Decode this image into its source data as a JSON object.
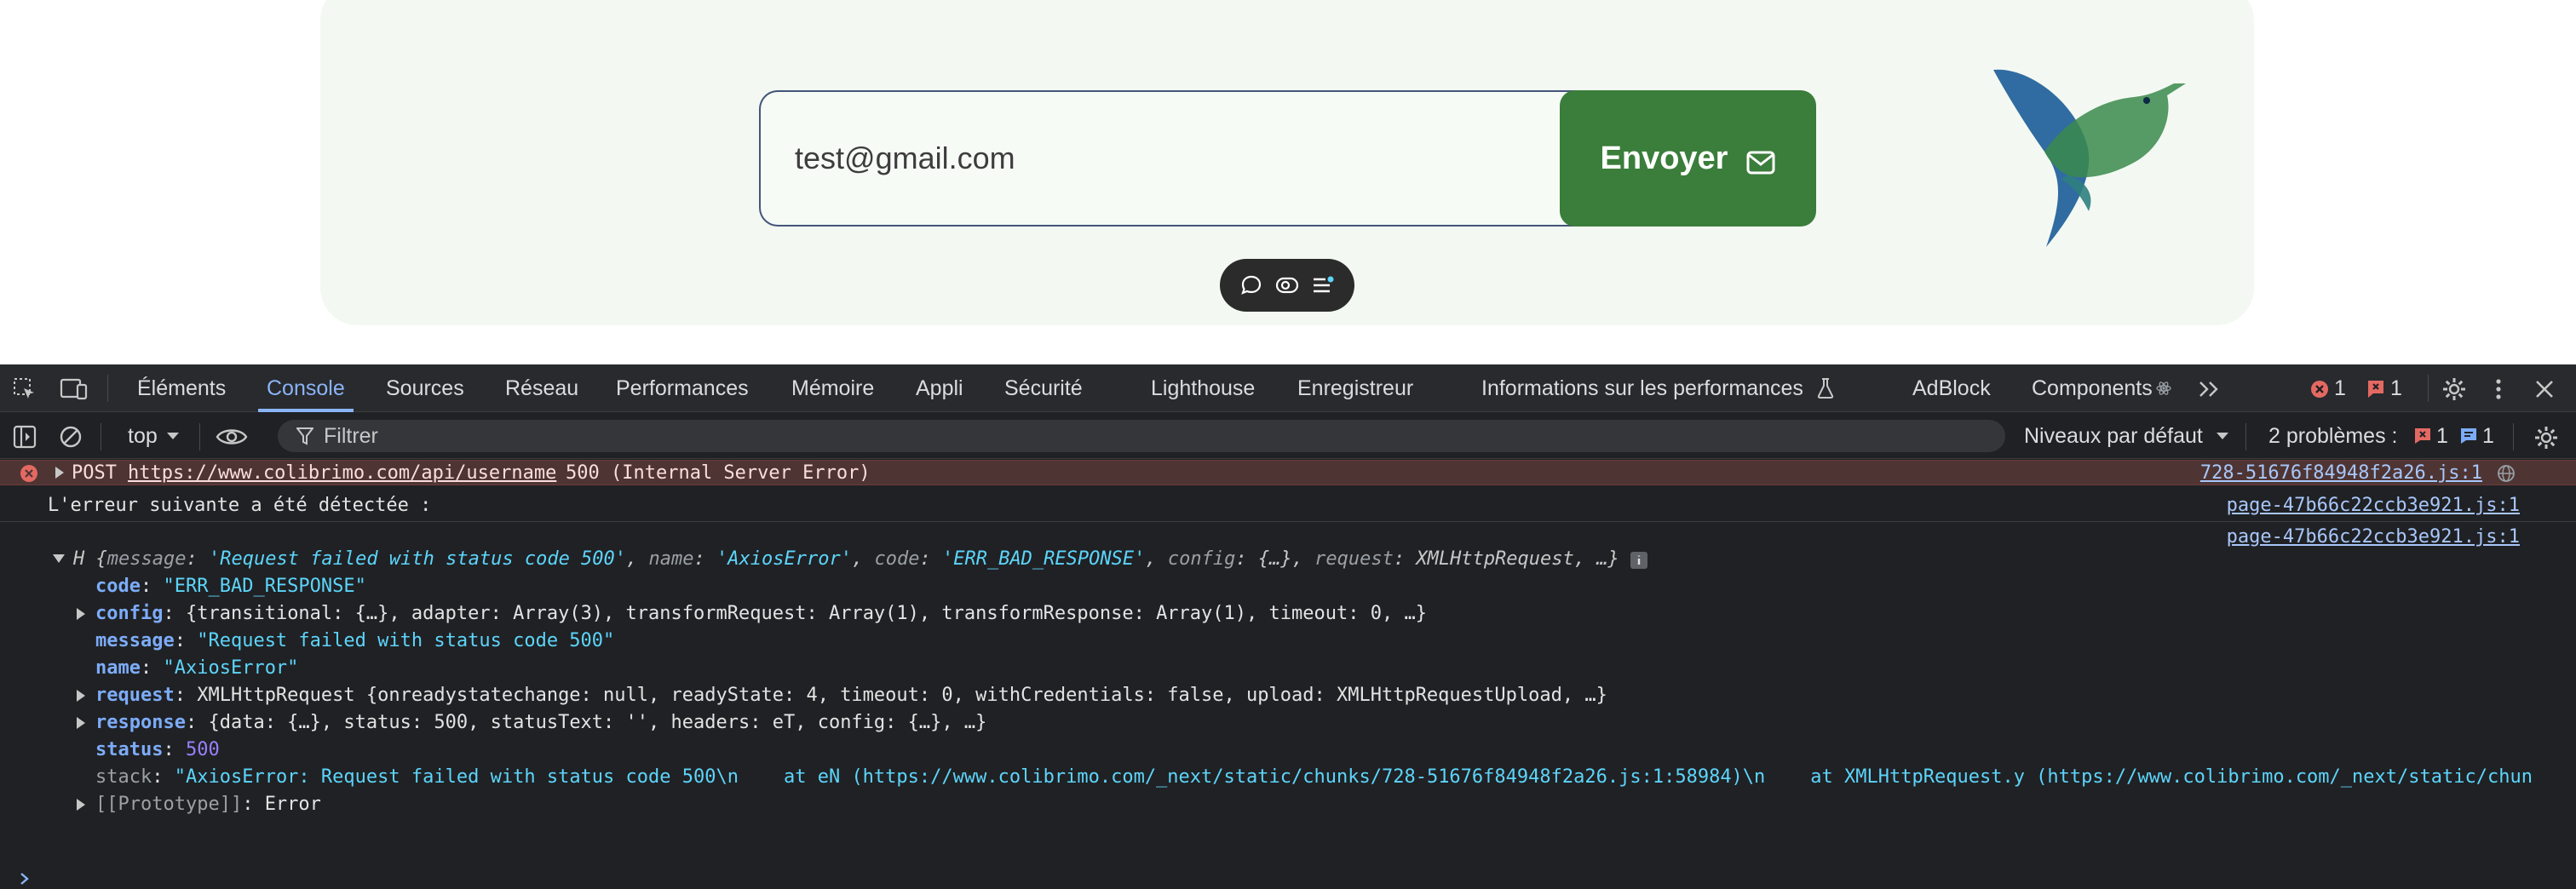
{
  "page": {
    "email_value": "test@gmail.com",
    "send_label": "Envoyer"
  },
  "devtools": {
    "tabs": [
      "Éléments",
      "Console",
      "Sources",
      "Réseau",
      "Performances",
      "Mémoire",
      "Appli",
      "Sécurité",
      "Lighthouse",
      "Enregistreur",
      "Informations sur les performances",
      "AdBlock",
      "Components"
    ],
    "active_tab": "Console",
    "error_count": "1",
    "issue_count": "1",
    "context": "top",
    "filter_placeholder": "Filtrer",
    "levels_label": "Niveaux par défaut",
    "problems_label": "2 problèmes :",
    "problems_errors": "1",
    "problems_info": "1",
    "colors": {
      "accent": "#8ab4f8",
      "error_bg": "#4e3534",
      "button_green": "#3b7d3b"
    }
  },
  "console": {
    "error": {
      "method": "POST",
      "url": "https://www.colibrimo.com/api/username",
      "status": "500 (Internal Server Error)",
      "source": "728-51676f84948f2a26.js:1"
    },
    "log_message": "L'erreur suivante a été détectée :",
    "log_source": "page-47b66c22ccb3e921.js:1",
    "obj_source": "page-47b66c22ccb3e921.js:1",
    "summary": {
      "prefix": "H {",
      "parts": [
        [
          "message",
          "'Request failed with status code 500'"
        ],
        [
          "name",
          "'AxiosError'"
        ],
        [
          "code",
          "'ERR_BAD_RESPONSE'"
        ],
        [
          "config",
          "{…}"
        ],
        [
          "request",
          "XMLHttpRequest"
        ]
      ],
      "suffix": ", …}"
    },
    "props": {
      "code_key": "code",
      "code_val": "\"ERR_BAD_RESPONSE\"",
      "config_key": "config",
      "config_val": "{transitional: {…}, adapter: Array(3), transformRequest: Array(1), transformResponse: Array(1), timeout: 0, …}",
      "message_key": "message",
      "message_val": "\"Request failed with status code 500\"",
      "name_key": "name",
      "name_val": "\"AxiosError\"",
      "request_key": "request",
      "request_val": "XMLHttpRequest {onreadystatechange: null, readyState: 4, timeout: 0, withCredentials: false, upload: XMLHttpRequestUpload, …}",
      "response_key": "response",
      "response_val": "{data: {…}, status: 500, statusText: '', headers: eT, config: {…}, …}",
      "status_key": "status",
      "status_val": "500",
      "stack_key": "stack",
      "stack_val": "\"AxiosError: Request failed with status code 500\\n    at eN (https://www.colibrimo.com/_next/static/chunks/728-51676f84948f2a26.js:1:58984)\\n    at XMLHttpRequest.y (https://www.colibrimo.com/_next/static/chun",
      "proto_key": "[[Prototype]]",
      "proto_val": "Error"
    }
  }
}
